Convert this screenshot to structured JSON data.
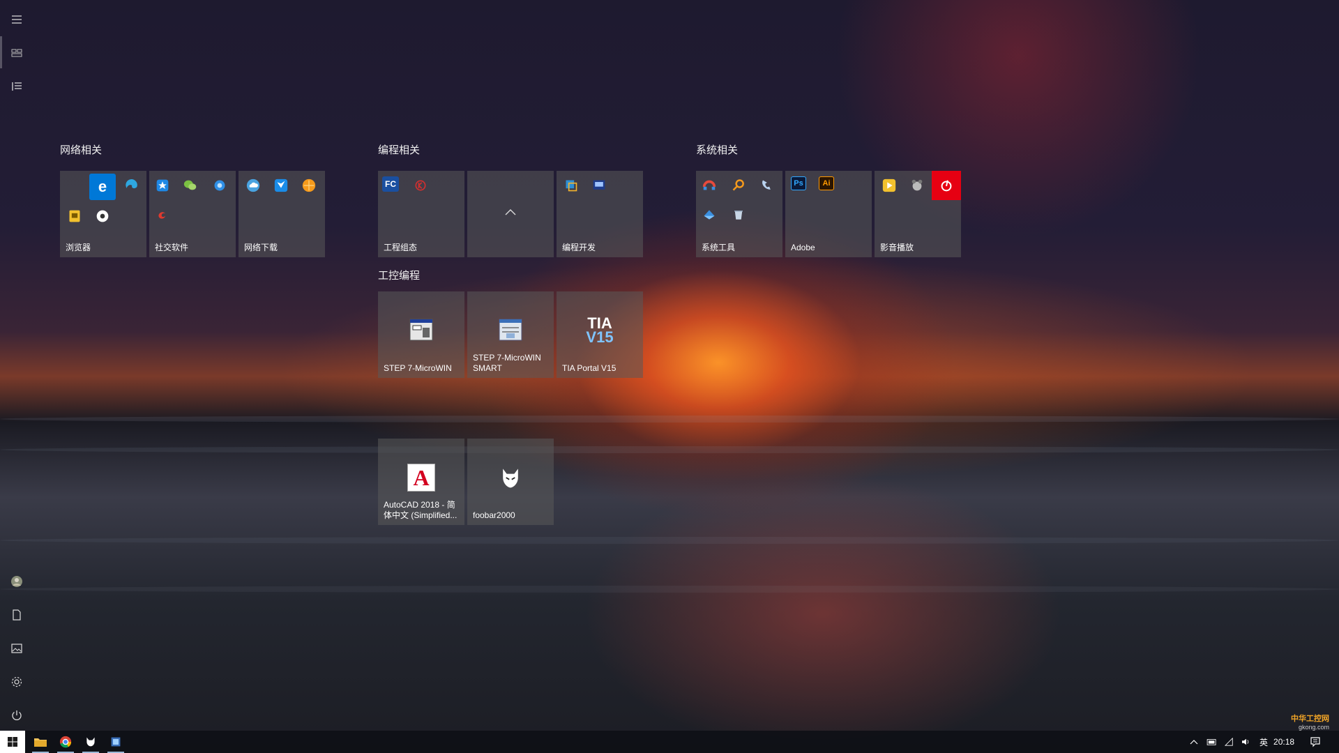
{
  "rail": {
    "items": [
      {
        "name": "hamburger-menu-icon"
      },
      {
        "name": "tiles-view-icon"
      },
      {
        "name": "all-apps-list-icon"
      },
      {
        "name": "user-avatar"
      },
      {
        "name": "documents-icon"
      },
      {
        "name": "pictures-icon"
      },
      {
        "name": "settings-gear-icon"
      },
      {
        "name": "power-icon"
      }
    ]
  },
  "groups": {
    "network": {
      "title": "网络相关"
    },
    "programming": {
      "title": "编程相关"
    },
    "system": {
      "title": "系统相关"
    },
    "industrial": {
      "title": "工控编程"
    }
  },
  "tiles": {
    "browser": {
      "label": "浏览器"
    },
    "social": {
      "label": "社交软件"
    },
    "download": {
      "label": "网络下载"
    },
    "engineering_config": {
      "label": "工程组态"
    },
    "dev": {
      "label": "编程开发"
    },
    "system_tools": {
      "label": "系统工具"
    },
    "adobe": {
      "label": "Adobe"
    },
    "media": {
      "label": "影音播放"
    },
    "step7": {
      "label": "STEP 7-MicroWIN"
    },
    "step7smart": {
      "label": "STEP 7-MicroWIN SMART"
    },
    "tia": {
      "label": "TIA Portal V15",
      "icon_text_1": "TIA",
      "icon_text_2": "V15"
    },
    "autocad": {
      "label": "AutoCAD 2018 - 简体中文 (Simplified...",
      "icon_text": "A"
    },
    "foobar": {
      "label": "foobar2000"
    }
  },
  "icons": {
    "fc": "FC",
    "ps": "Ps",
    "ai": "Ai"
  },
  "taskbar": {
    "ime": "英",
    "time": "20:18"
  },
  "watermark": {
    "line1": "中华工控网",
    "line2": "gkong.com"
  },
  "colors": {
    "tile_bg": "#5a5a5a",
    "edge_blue": "#0078d7",
    "netease_red": "#e60012",
    "adobe_ps_blue": "#31a8ff",
    "adobe_ai_orange": "#ff9a00"
  }
}
